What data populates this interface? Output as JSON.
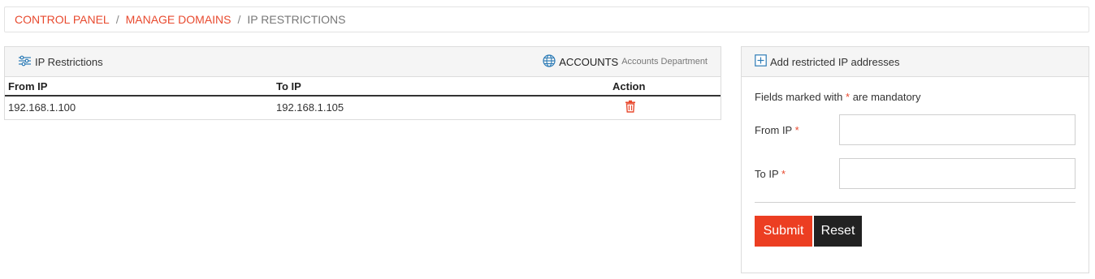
{
  "breadcrumb": {
    "items": [
      "CONTROL PANEL",
      "MANAGE DOMAINS"
    ],
    "separator": "/",
    "current": "IP RESTRICTIONS"
  },
  "left_panel": {
    "title": "IP Restrictions",
    "title_icon": "filter-sliders-icon",
    "account_icon": "globe-icon",
    "account_name": "ACCOUNTS",
    "account_department": "Accounts Department",
    "table": {
      "headers": [
        "From IP",
        "To IP",
        "Action"
      ],
      "rows": [
        {
          "from": "192.168.1.100",
          "to": "192.168.1.105",
          "action_icon": "trash-icon"
        }
      ]
    }
  },
  "right_panel": {
    "title": "Add restricted IP addresses",
    "title_icon": "plus-square-icon",
    "note_prefix": "Fields marked with",
    "note_star": "*",
    "note_suffix": "are mandatory",
    "fields": [
      {
        "label": "From IP",
        "required": "*",
        "value": ""
      },
      {
        "label": "To IP",
        "required": "*",
        "value": ""
      }
    ],
    "submit_label": "Submit",
    "reset_label": "Reset"
  },
  "colors": {
    "accent": "#e84a2f",
    "submit": "#ec3e22",
    "reset": "#222222",
    "icon_blue": "#2c7bb6"
  }
}
